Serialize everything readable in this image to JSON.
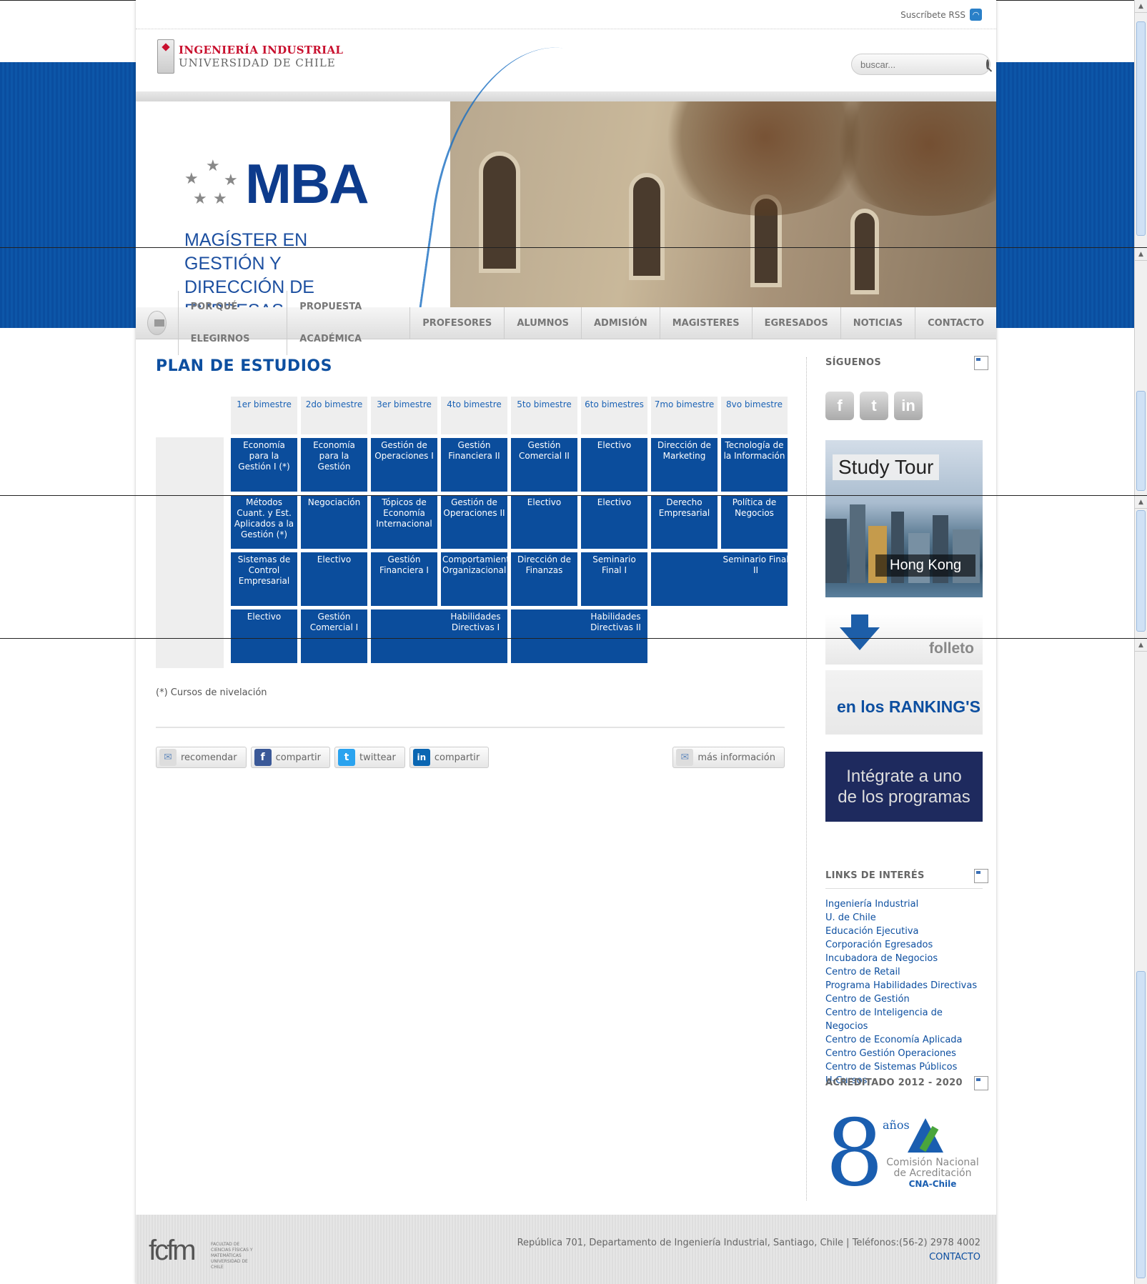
{
  "header": {
    "rss_label": "Suscríbete RSS",
    "logo_line1": "INGENIERÍA INDUSTRIAL",
    "logo_line2": "UNIVERSIDAD DE CHILE",
    "search_placeholder": "buscar..."
  },
  "hero": {
    "title": "MBA",
    "subtitle_line1": "MAGÍSTER EN GESTIÓN Y",
    "subtitle_line2": "DIRECCIÓN DE EMPRESAS"
  },
  "nav": [
    "POR QUÉ ELEGIRNOS",
    "PROPUESTA ACADÉMICA",
    "PROFESORES",
    "ALUMNOS",
    "ADMISIÓN",
    "MAGISTERES",
    "EGRESADOS",
    "NOTICIAS",
    "CONTACTO"
  ],
  "main": {
    "title": "PLAN DE ESTUDIOS",
    "headers": [
      "1er bimestre",
      "2do bimestre",
      "3er bimestre",
      "4to bimestre",
      "5to bimestre",
      "6to bimestres",
      "7mo bimestre",
      "8vo bimestre"
    ],
    "row1": [
      "Economía para la Gestión I (*)",
      "Economía para la Gestión",
      "Gestión de Operaciones I",
      "Gestión Financiera II",
      "Gestión Comercial II",
      "Electivo",
      "Dirección de Marketing",
      "Tecnología de la Información"
    ],
    "row2": [
      "Métodos Cuant. y Est. Aplicados a la Gestión (*)",
      "Negociación",
      "Tópicos de Economía Internacional",
      "Gestión de Operaciones II",
      "Electivo",
      "Electivo",
      "Derecho Empresarial",
      "Política de Negocios"
    ],
    "row3": [
      "Sistemas de Control Empresarial",
      "Electivo",
      "Gestión Financiera I",
      "Comportamiento Organizacional",
      "Dirección de Finanzas",
      "Seminario Final I",
      "Seminario Final II"
    ],
    "row4": [
      "Electivo",
      "Gestión Comercial I",
      "Habilidades Directivas I",
      "Habilidades Directivas II"
    ],
    "note": "(*) Cursos de nivelación",
    "share": [
      "recomendar",
      "compartir",
      "twittear",
      "compartir"
    ],
    "more": "más información"
  },
  "sidebar": {
    "follow_title": "SÍGUENOS",
    "social": [
      "f",
      "t",
      "in"
    ],
    "study_tour": "Study Tour",
    "hong_kong": "Hong Kong",
    "folleto": "folleto",
    "rankings": "en los RANKING'S",
    "integrate_line1": "Intégrate a uno",
    "integrate_line2": "de los programas",
    "links_title": "LINKS DE INTERÉS",
    "links": [
      "Ingeniería Industrial",
      "U. de Chile",
      "Educación Ejecutiva",
      "Corporación Egresados",
      "Incubadora de Negocios",
      "Centro de Retail",
      "Programa Habilidades Directivas",
      "Centro de Gestión",
      "Centro de Inteligencia de Negocios",
      "Centro de Economía Aplicada",
      "Centro Gestión Operaciones",
      "Centro de Sistemas Públicos",
      "U-Cursos"
    ],
    "acred_title": "ACREDITADO 2012 - 2020",
    "cna_number": "8",
    "cna_years": "años",
    "cna_label1": "Comisión Nacional",
    "cna_label2": "de Acreditación",
    "cna_label3": "CNA-Chile"
  },
  "footer": {
    "logo": "fcfm",
    "logo_small": "FACULTAD DE CIENCIAS FÍSICAS Y MATEMÁTICAS UNIVERSIDAD DE CHILE",
    "address": "República 701, Departamento de Ingeniería Industrial, Santiago, Chile | Teléfonos:(56-2) 2978 4002",
    "contact": "CONTACTO"
  },
  "colors": {
    "brand_blue": "#0b4d9c",
    "accent_red": "#c8102e"
  }
}
